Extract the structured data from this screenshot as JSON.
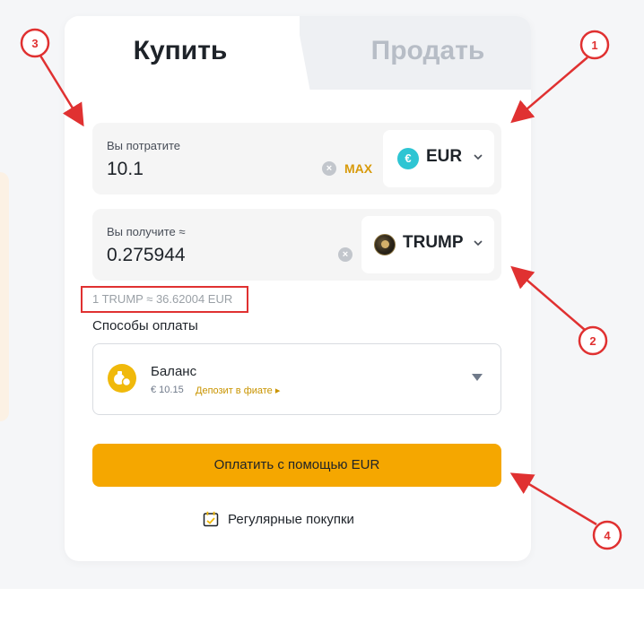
{
  "tabs": {
    "buy": "Купить",
    "sell": "Продать"
  },
  "spend": {
    "label": "Вы потратите",
    "value": "10.1",
    "max_label": "MAX",
    "currency": "EUR",
    "currency_icon": "€"
  },
  "receive": {
    "label": "Вы получите ≈",
    "value": "0.275944",
    "currency": "TRUMP"
  },
  "rate": "1 TRUMP ≈ 36.62004 EUR",
  "payment": {
    "title": "Способы оплаты",
    "method_name": "Баланс",
    "balance": "€ 10.15",
    "deposit_link": "Депозит в фиате ▸"
  },
  "pay_button": "Оплатить с помощью EUR",
  "recurring_label": "Регулярные покупки",
  "annotations": [
    "1",
    "2",
    "3",
    "4"
  ],
  "colors": {
    "accent": "#f5a700",
    "annotation": "#e03131",
    "eur_icon": "#2ec5d3",
    "max": "#d89a0a"
  }
}
